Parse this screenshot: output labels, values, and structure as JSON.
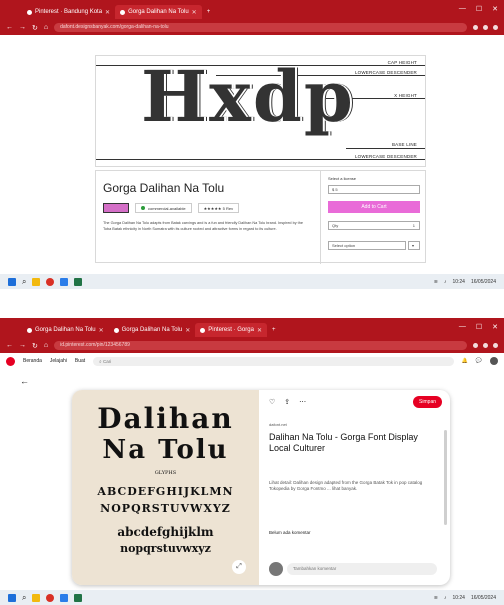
{
  "shot1": {
    "tabs": [
      {
        "label": "Pinterest · Bandung Kota",
        "active": false
      },
      {
        "label": "Gorga Dalihan Na Tolu",
        "active": true
      }
    ],
    "url": "dafont.designsbanyak.com/gorga-dalihan-na-tolu",
    "specimen": {
      "glyphs": "Hxdp",
      "guides": [
        "CAP HEIGHT",
        "LOWERCASE DESCENDER",
        "X HEIGHT",
        "BASE LINE",
        "LOWERCASE DESCENDER"
      ]
    },
    "font": {
      "title": "Gorga Dalihan Na Tolu",
      "status": "commercial-available",
      "rating": "★★★★★ 5 Rev",
      "description": "The Gorga Dalihan Na Tolu adapts from Batak carvings and is a fun and friendly Dalihan Na Tolu brand. Inspired by the Toba Batak ethnicity in North Sumatra with its culture rooted and attractive forms in regard to its culture.",
      "buy_label": "Add to Cart",
      "license_label": "Select a license",
      "license_value": "$ 5",
      "qty_label": "Qty",
      "qty_value": "1",
      "select_placeholder": "Select option"
    }
  },
  "shot2": {
    "tabs": [
      {
        "label": "Gorga Dalihan Na Tolu",
        "active": false
      },
      {
        "label": "Gorga Dalihan Na Tolu",
        "active": false
      },
      {
        "label": "Pinterest · Gorga",
        "active": true
      }
    ],
    "url": "id.pinterest.com/pin/123456789",
    "nav": {
      "home": "Beranda",
      "explore": "Jelajahi",
      "create": "Buat",
      "search": "Cari"
    },
    "pin": {
      "line1": "Dalihan",
      "line2": "Na Tolu",
      "sub": "GLYPHS",
      "alpha": "ABCDEFGHIJKLMN",
      "alpha2": "NOPQRSTUVWXYZ",
      "lower1": "abcdefghijklm",
      "lower2": "nopqrstuvwxyz",
      "domain": "dafont.net",
      "title": "Dalihan Na Tolu - Gorga Font Display Local Culturer",
      "desc": "Lihat detail: Dalihan design adapted from the Gorga Batak Tok in pop catalog Tokopedia by Gorga Fontmo ... lihat banyak.",
      "save_label": "Simpan",
      "comments": "Belum ada komentar",
      "add_comment": "Tambahkan komentar"
    }
  },
  "taskbar": {
    "time": "10:24",
    "date": "16/05/2024"
  },
  "colors": {
    "chrome": "#b0151d",
    "pinterest": "#e60023",
    "buy": "#e96bd8"
  }
}
